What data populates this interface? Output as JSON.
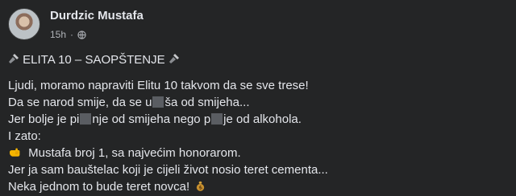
{
  "post": {
    "author": "Durdzic Mustafa",
    "time": "15h",
    "separator": "·",
    "title": "ELITA 10 – SAOPŠTENJE",
    "lines": {
      "l1": "Ljudi, moramo napraviti Elitu 10 takvom da se sve trese!",
      "l2a": "Da se narod smije, da se u",
      "l2b": "ša od smijeha...",
      "l3a": "Jer bolje je pi",
      "l3b": "nje od smijeha nego p",
      "l3c": "je od alkohola.",
      "l4": "I zato:",
      "l5": "Mustafa broj 1, sa najvećim honorarom.",
      "l6": "Jer ja sam bauštelac koji je cijeli život nosio teret cementa...",
      "l7": "Neka jednom to bude teret novca!"
    }
  },
  "icons": {
    "avatar": "profile-photo",
    "privacy": "globe-icon",
    "title_left": "microphone-icon",
    "title_right": "microphone-icon",
    "line5": "pointing-hand-icon",
    "line7": "money-bag-icon"
  },
  "colors": {
    "background": "#242526",
    "text": "#e4e6eb",
    "muted": "#b0b3b8",
    "redaction": "#5a5d62"
  }
}
